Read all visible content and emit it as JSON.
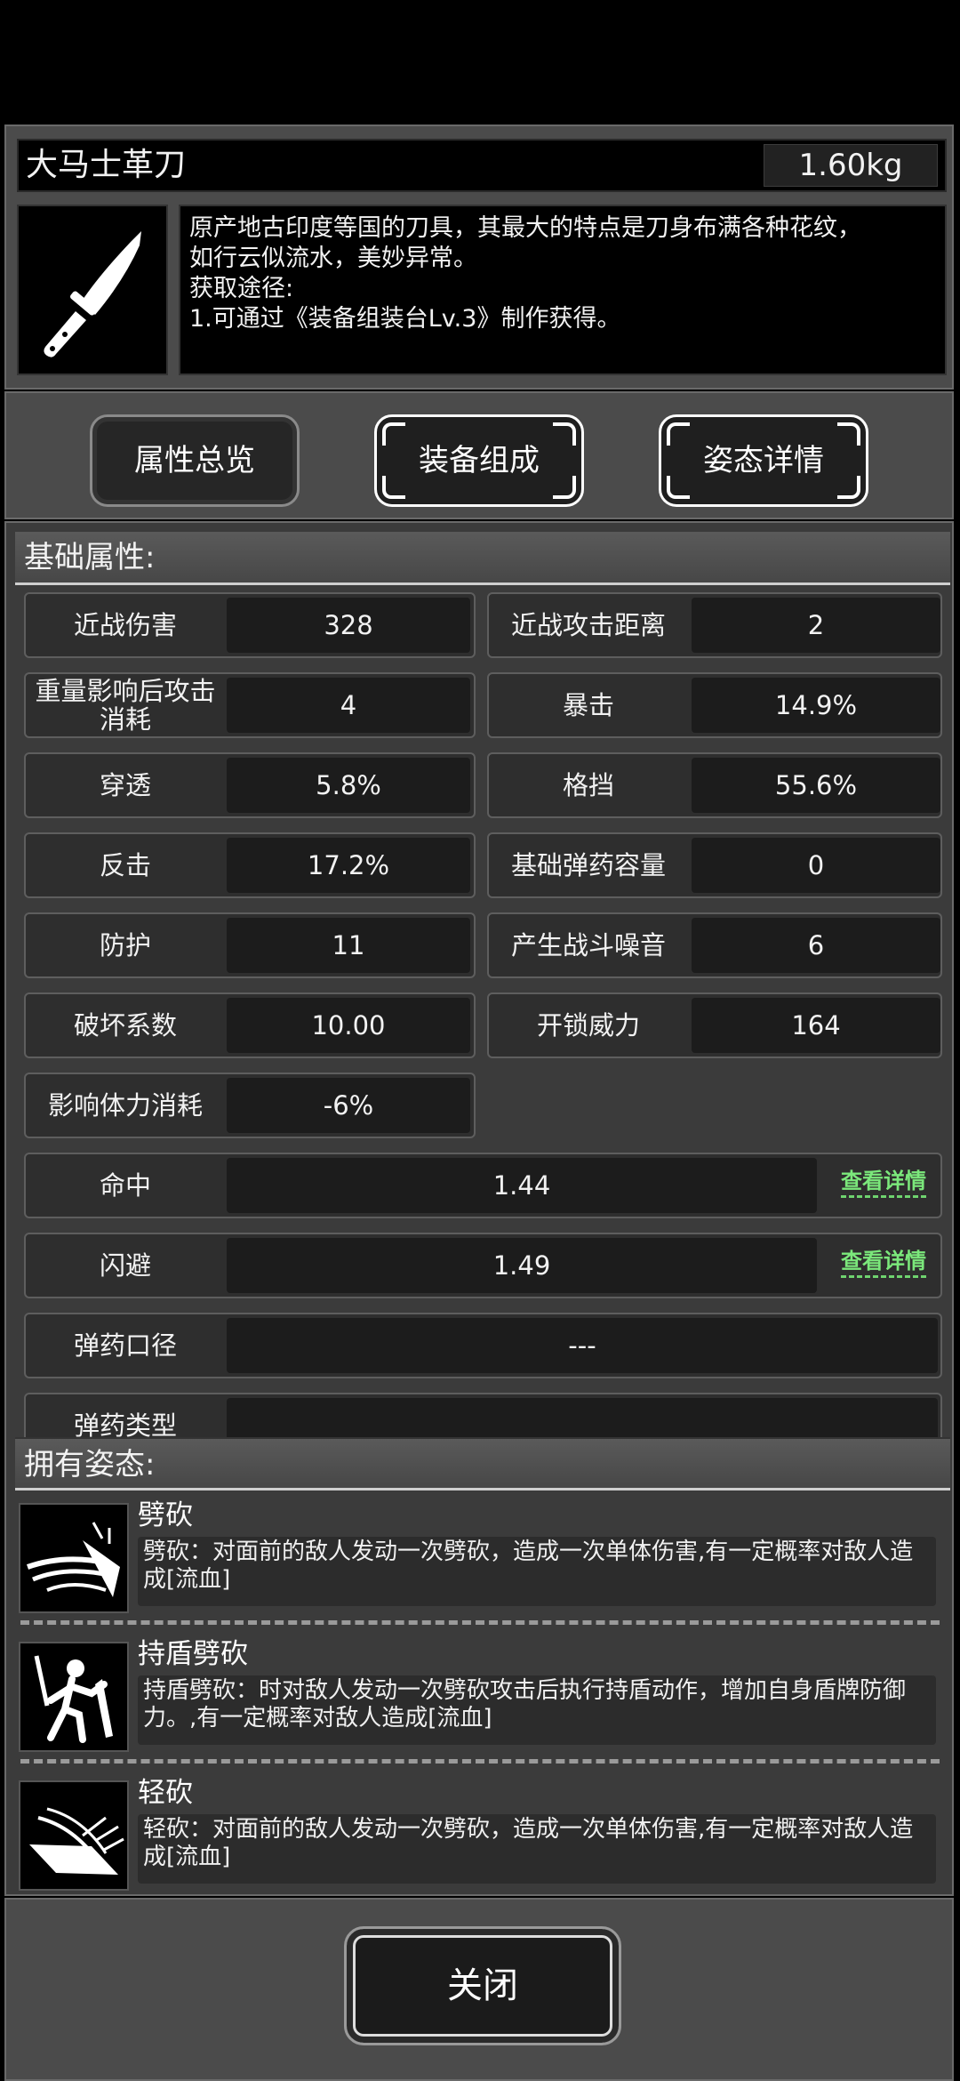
{
  "item": {
    "name": "大马士革刀",
    "weight": "1.60kg",
    "icon": "knife-icon",
    "description": [
      "原产地古印度等国的刀具，其最大的特点是刀身布满各种花纹，",
      "如行云似流水，美妙异常。",
      "获取途径:",
      "1.可通过《装备组装台Lv.3》制作获得。"
    ]
  },
  "tabs": [
    {
      "label": "属性总览"
    },
    {
      "label": "装备组成"
    },
    {
      "label": "姿态详情"
    }
  ],
  "basic": {
    "title": "基础属性:",
    "attrs": [
      {
        "label": "近战伤害",
        "value": "328"
      },
      {
        "label": "近战攻击距离",
        "value": "2"
      },
      {
        "label": "重量影响后攻击消耗",
        "value": "4"
      },
      {
        "label": "暴击",
        "value": "14.9%"
      },
      {
        "label": "穿透",
        "value": "5.8%"
      },
      {
        "label": "格挡",
        "value": "55.6%"
      },
      {
        "label": "反击",
        "value": "17.2%"
      },
      {
        "label": "基础弹药容量",
        "value": "0"
      },
      {
        "label": "防护",
        "value": "11"
      },
      {
        "label": "产生战斗噪音",
        "value": "6"
      },
      {
        "label": "破坏系数",
        "value": "10.00"
      },
      {
        "label": "开锁威力",
        "value": "164"
      },
      {
        "label": "影响体力消耗",
        "value": "-6%"
      }
    ],
    "wide": [
      {
        "label": "命中",
        "value": "1.44",
        "link": "查看详情"
      },
      {
        "label": "闪避",
        "value": "1.49",
        "link": "查看详情"
      },
      {
        "label": "弹药口径",
        "value": "---"
      },
      {
        "label": "弹药类型",
        "value": ""
      }
    ]
  },
  "stances": {
    "title": "拥有姿态:",
    "items": [
      {
        "name": "劈砍",
        "icon": "slash-icon",
        "desc": "劈砍：对面前的敌人发动一次劈砍，造成一次单体伤害,有一定概率对敌人造成[流血]"
      },
      {
        "name": "持盾劈砍",
        "icon": "shield-slash-icon",
        "desc": "持盾劈砍：时对敌人发动一次劈砍攻击后执行持盾动作，增加自身盾牌防御力。,有一定概率对敌人造成[流血]"
      },
      {
        "name": "轻砍",
        "icon": "light-slash-icon",
        "desc": "轻砍：对面前的敌人发动一次劈砍，造成一次单体伤害,有一定概率对敌人造成[流血]"
      }
    ]
  },
  "close_label": "关闭"
}
